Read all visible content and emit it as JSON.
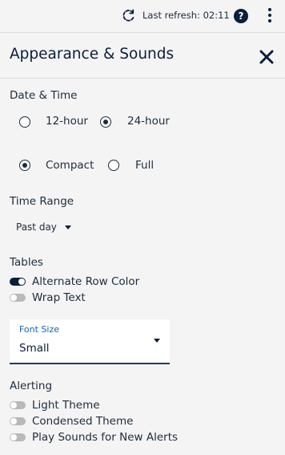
{
  "topbar": {
    "refresh_text": "Last refresh: 02:11",
    "help_glyph": "?",
    "icons": [
      "refresh-icon",
      "help-icon",
      "more-vertical-icon"
    ]
  },
  "header": {
    "title": "Appearance & Sounds",
    "close_icon": "close-icon"
  },
  "date_time": {
    "label": "Date & Time",
    "clock_options": [
      {
        "label": "12-hour",
        "checked": false
      },
      {
        "label": "24-hour",
        "checked": true
      }
    ],
    "format_options": [
      {
        "label": "Compact",
        "checked": true
      },
      {
        "label": "Full",
        "checked": false
      }
    ]
  },
  "time_range": {
    "label": "Time Range",
    "selected": "Past day"
  },
  "tables": {
    "label": "Tables",
    "toggles": [
      {
        "label": "Alternate Row Color",
        "on": true
      },
      {
        "label": "Wrap Text",
        "on": false
      }
    ]
  },
  "font_size": {
    "label": "Font Size",
    "value": "Small"
  },
  "alerting": {
    "label": "Alerting",
    "toggles": [
      {
        "label": "Light Theme",
        "on": false
      },
      {
        "label": "Condensed Theme",
        "on": false
      },
      {
        "label": "Play Sounds for New Alerts",
        "on": false
      }
    ]
  },
  "colors": {
    "primary": "#0d1e3a",
    "text": "#1d2c3c",
    "accent_blue": "#1a5fb4",
    "background": "#f4f4f4",
    "toggle_off": "#b9b9b9"
  }
}
